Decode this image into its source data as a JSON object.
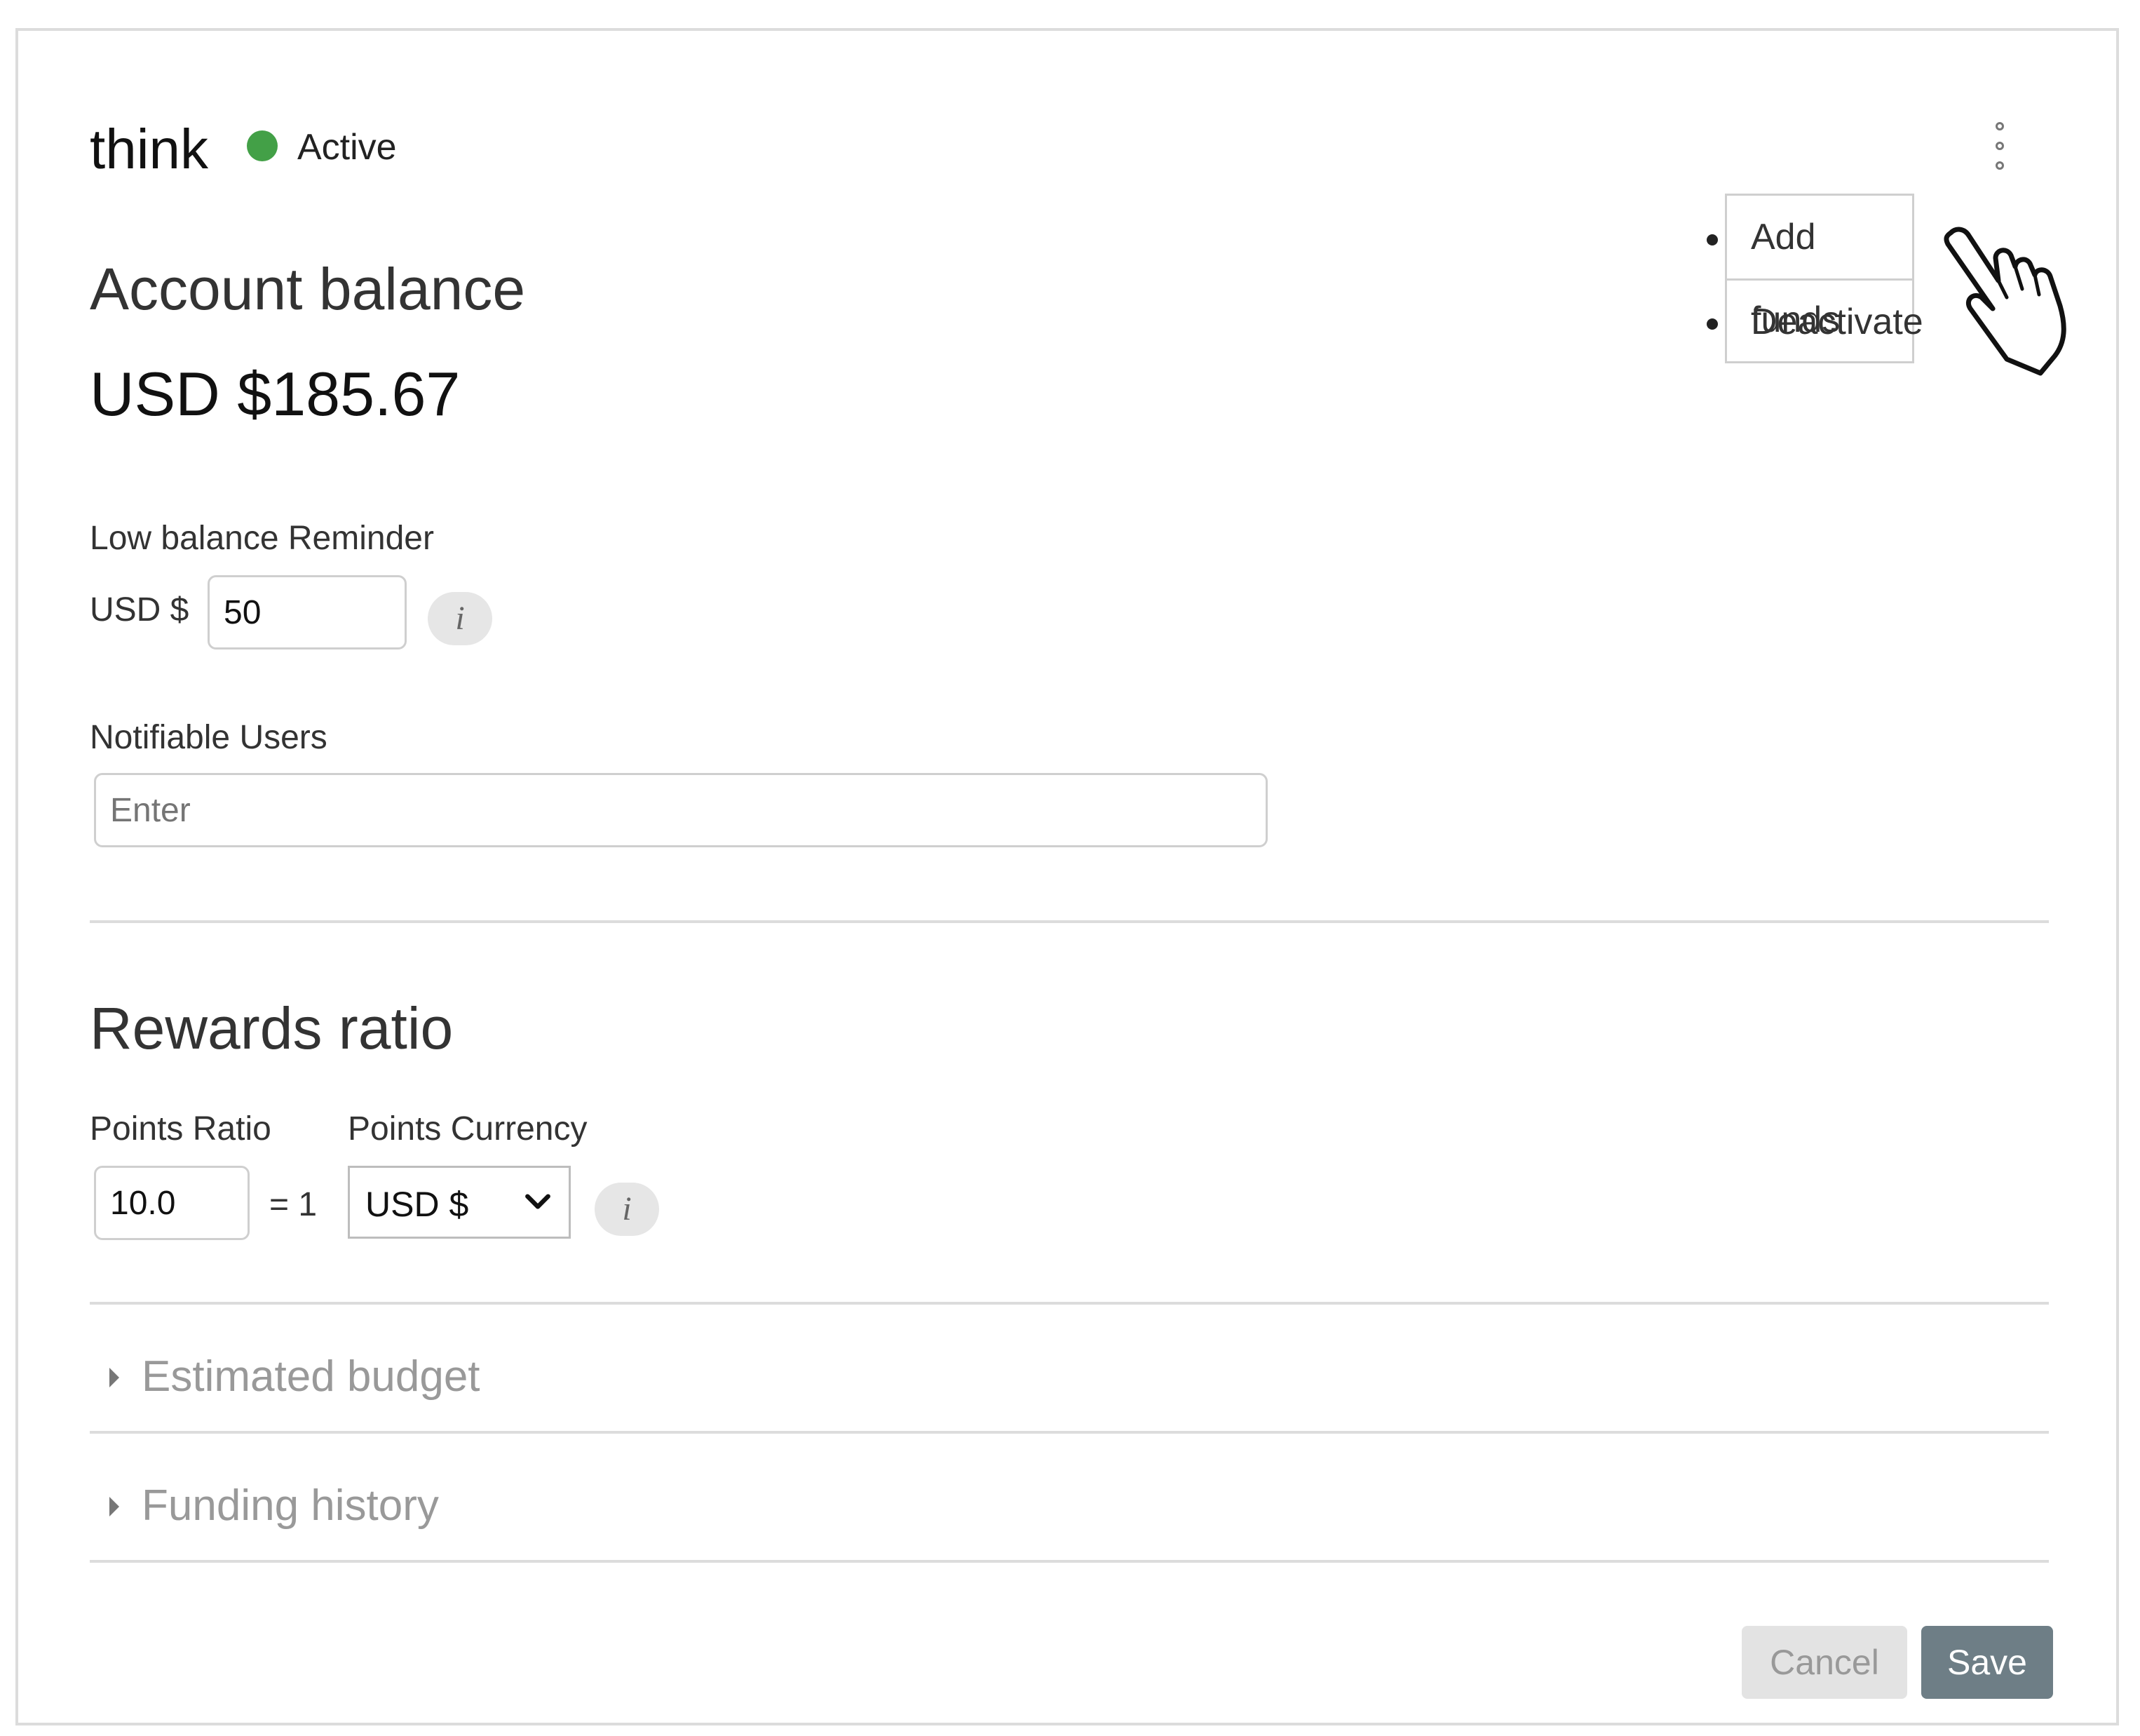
{
  "header": {
    "title": "think",
    "status": "Active",
    "status_color": "#43a047",
    "more_icon": "kebab-vertical-icon"
  },
  "menu": {
    "items": [
      {
        "label": "Add funds"
      },
      {
        "label": "Deactivate"
      }
    ],
    "cursor_icon": "hand-pointer-icon"
  },
  "account": {
    "heading": "Account balance",
    "balance": "USD $185.67",
    "low_balance_label": "Low balance Reminder",
    "currency_prefix": "USD $",
    "low_balance_value": "50",
    "info_glyph": "i",
    "notifiable_label": "Notifiable Users",
    "notifiable_placeholder": "Enter"
  },
  "rewards": {
    "heading": "Rewards ratio",
    "points_ratio_label": "Points Ratio",
    "points_currency_label": "Points Currency",
    "points_ratio_value": "10.0",
    "equals_text": "= 1",
    "currency_selected": "USD $",
    "info_glyph": "i"
  },
  "sections": [
    {
      "label": "Estimated budget",
      "expanded": false
    },
    {
      "label": "Funding history",
      "expanded": false
    }
  ],
  "footer": {
    "cancel_label": "Cancel",
    "save_label": "Save",
    "save_color": "#6e7e86"
  }
}
